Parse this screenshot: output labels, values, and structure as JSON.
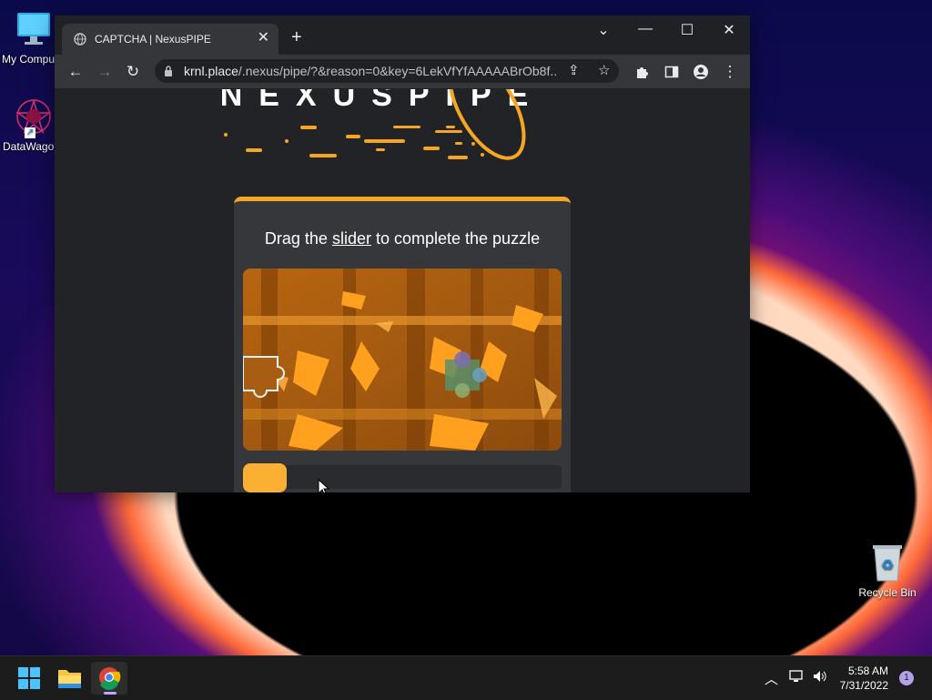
{
  "desktop": {
    "icons": [
      {
        "label": "My Compu"
      },
      {
        "label": "DataWago"
      },
      {
        "label": "Recycle Bin"
      }
    ]
  },
  "browser": {
    "tab_title": "CAPTCHA | NexusPIPE",
    "url_host": "krnl.place",
    "url_path": "/.nexus/pipe/?&reason=0&key=6LekVfYfAAAAABrOb8f..."
  },
  "page": {
    "logo_text": "NEXUSPIPE",
    "captcha": {
      "heading_before": "Drag the ",
      "heading_link": "slider",
      "heading_after": " to complete the puzzle",
      "slider_progress": 0
    }
  },
  "taskbar": {
    "time": "5:58 AM",
    "date": "7/31/2022",
    "notification_count": "1"
  },
  "colors": {
    "accent": "#f5a623",
    "knob": "#fbb034",
    "page_bg": "#222326",
    "card_bg": "#35373b"
  }
}
